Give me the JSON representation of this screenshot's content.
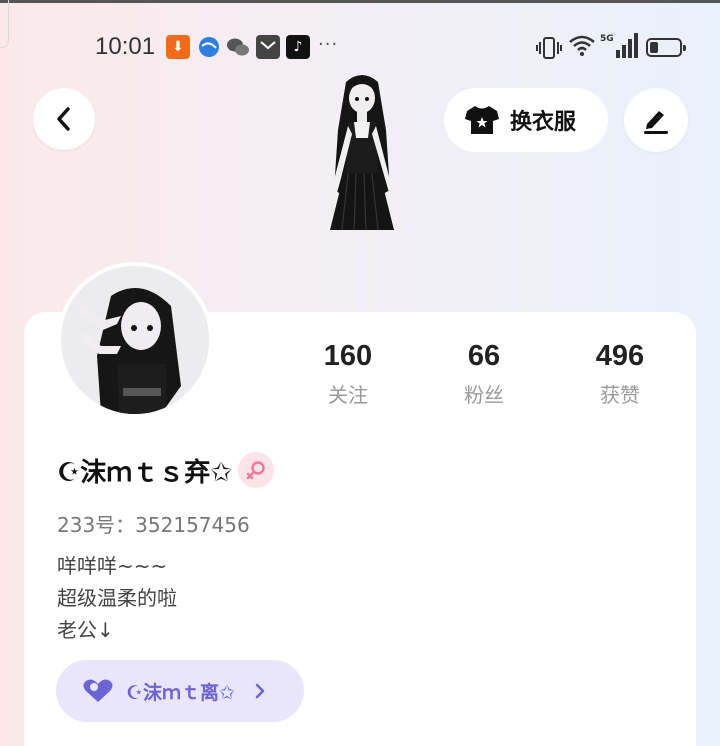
{
  "status_bar": {
    "time": "10:01",
    "more": "···",
    "network": "5G"
  },
  "header": {
    "back_icon": "chevron-left-icon",
    "outfit_label": "换衣服",
    "outfit_icon": "shirt-icon",
    "edit_icon": "pen-icon"
  },
  "stats": [
    {
      "value": "160",
      "label": "关注"
    },
    {
      "value": "66",
      "label": "粉丝"
    },
    {
      "value": "496",
      "label": "获赞"
    }
  ],
  "profile": {
    "nickname": "☪沫ｍｔｓ弃✩",
    "gender_icon": "female-icon",
    "user_id": "233号：352157456",
    "bio_lines": [
      "咩咩咩~~~",
      "超级温柔的啦",
      "老公↓"
    ]
  },
  "partner": {
    "icon": "heart-moon-icon",
    "name": "☪沫ｍｔ离✩"
  },
  "colors": {
    "accent": "#6c63d6",
    "partner_bg": "#e9e6fb",
    "gender_bg": "#fde4ea",
    "gender_icon": "#f07a9c"
  }
}
